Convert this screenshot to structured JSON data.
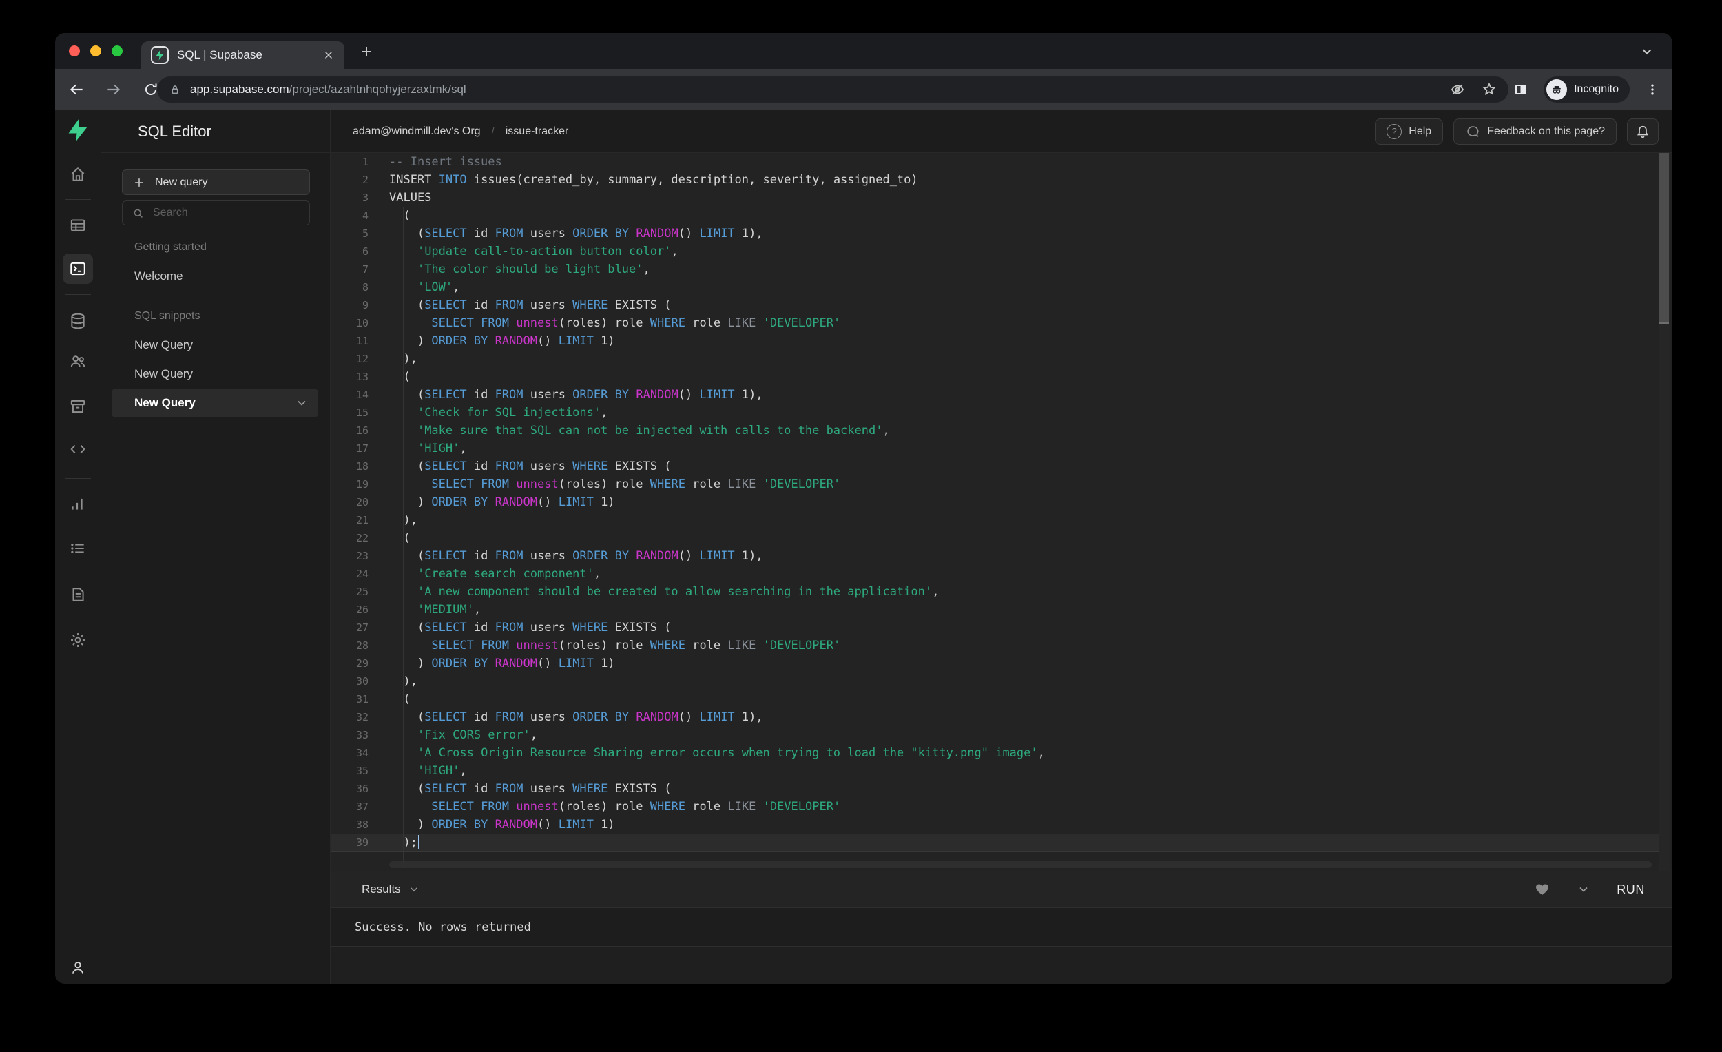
{
  "browser": {
    "tab_title": "SQL | Supabase",
    "url_domain": "app.supabase.com",
    "url_path": "/project/azahtnhqohyjerzaxtmk/sql",
    "incognito_label": "Incognito"
  },
  "header": {
    "breadcrumb_org": "adam@windmill.dev's Org",
    "breadcrumb_separator": "/",
    "breadcrumb_project": "issue-tracker",
    "help_label": "Help",
    "help_icon_glyph": "?",
    "feedback_label": "Feedback on this page?"
  },
  "panel": {
    "title": "SQL Editor",
    "new_query_button": "New query",
    "search_placeholder": "Search",
    "sections": [
      {
        "label": "Getting started",
        "items": [
          "Welcome"
        ],
        "selected_index": -1
      },
      {
        "label": "SQL snippets",
        "items": [
          "New Query",
          "New Query",
          "New Query"
        ],
        "selected_index": 2
      }
    ]
  },
  "colors": {
    "accent_green": "#3ecf8e",
    "keyword": "#569cd6",
    "function": "#ca35ca",
    "string": "#2ea97d",
    "comment": "#6e757d",
    "editor_background": "#232323"
  },
  "editor": {
    "lines": [
      [
        [
          "c",
          "-- Insert issues"
        ]
      ],
      [
        [
          "d",
          "INSERT "
        ],
        [
          "k",
          "INTO"
        ],
        [
          "d",
          " issues(created_by, summary, description, severity, assigned_to)"
        ]
      ],
      [
        [
          "d",
          "VALUES"
        ]
      ],
      [
        [
          "d",
          "  ("
        ]
      ],
      [
        [
          "d",
          "    ("
        ],
        [
          "k",
          "SELECT"
        ],
        [
          "d",
          " id "
        ],
        [
          "k",
          "FROM"
        ],
        [
          "d",
          " users "
        ],
        [
          "k",
          "ORDER"
        ],
        [
          "d",
          " "
        ],
        [
          "k",
          "BY"
        ],
        [
          "d",
          " "
        ],
        [
          "f",
          "RANDOM"
        ],
        [
          "d",
          "() "
        ],
        [
          "k",
          "LIMIT"
        ],
        [
          "d",
          " 1),"
        ]
      ],
      [
        [
          "d",
          "    "
        ],
        [
          "s",
          "'Update call-to-action button color'"
        ],
        [
          "d",
          ","
        ]
      ],
      [
        [
          "d",
          "    "
        ],
        [
          "s",
          "'The color should be light blue'"
        ],
        [
          "d",
          ","
        ]
      ],
      [
        [
          "d",
          "    "
        ],
        [
          "s",
          "'LOW'"
        ],
        [
          "d",
          ","
        ]
      ],
      [
        [
          "d",
          "    ("
        ],
        [
          "k",
          "SELECT"
        ],
        [
          "d",
          " id "
        ],
        [
          "k",
          "FROM"
        ],
        [
          "d",
          " users "
        ],
        [
          "k",
          "WHERE"
        ],
        [
          "d",
          " EXISTS ("
        ]
      ],
      [
        [
          "d",
          "      "
        ],
        [
          "k",
          "SELECT"
        ],
        [
          "d",
          " "
        ],
        [
          "k",
          "FROM"
        ],
        [
          "d",
          " "
        ],
        [
          "f",
          "unnest"
        ],
        [
          "d",
          "(roles) role "
        ],
        [
          "k",
          "WHERE"
        ],
        [
          "d",
          " role "
        ],
        [
          "g",
          "LIKE"
        ],
        [
          "d",
          " "
        ],
        [
          "s",
          "'DEVELOPER'"
        ]
      ],
      [
        [
          "d",
          "    ) "
        ],
        [
          "k",
          "ORDER"
        ],
        [
          "d",
          " "
        ],
        [
          "k",
          "BY"
        ],
        [
          "d",
          " "
        ],
        [
          "f",
          "RANDOM"
        ],
        [
          "d",
          "() "
        ],
        [
          "k",
          "LIMIT"
        ],
        [
          "d",
          " 1)"
        ]
      ],
      [
        [
          "d",
          "  ),"
        ]
      ],
      [
        [
          "d",
          "  ("
        ]
      ],
      [
        [
          "d",
          "    ("
        ],
        [
          "k",
          "SELECT"
        ],
        [
          "d",
          " id "
        ],
        [
          "k",
          "FROM"
        ],
        [
          "d",
          " users "
        ],
        [
          "k",
          "ORDER"
        ],
        [
          "d",
          " "
        ],
        [
          "k",
          "BY"
        ],
        [
          "d",
          " "
        ],
        [
          "f",
          "RANDOM"
        ],
        [
          "d",
          "() "
        ],
        [
          "k",
          "LIMIT"
        ],
        [
          "d",
          " 1),"
        ]
      ],
      [
        [
          "d",
          "    "
        ],
        [
          "s",
          "'Check for SQL injections'"
        ],
        [
          "d",
          ","
        ]
      ],
      [
        [
          "d",
          "    "
        ],
        [
          "s",
          "'Make sure that SQL can not be injected with calls to the backend'"
        ],
        [
          "d",
          ","
        ]
      ],
      [
        [
          "d",
          "    "
        ],
        [
          "s",
          "'HIGH'"
        ],
        [
          "d",
          ","
        ]
      ],
      [
        [
          "d",
          "    ("
        ],
        [
          "k",
          "SELECT"
        ],
        [
          "d",
          " id "
        ],
        [
          "k",
          "FROM"
        ],
        [
          "d",
          " users "
        ],
        [
          "k",
          "WHERE"
        ],
        [
          "d",
          " EXISTS ("
        ]
      ],
      [
        [
          "d",
          "      "
        ],
        [
          "k",
          "SELECT"
        ],
        [
          "d",
          " "
        ],
        [
          "k",
          "FROM"
        ],
        [
          "d",
          " "
        ],
        [
          "f",
          "unnest"
        ],
        [
          "d",
          "(roles) role "
        ],
        [
          "k",
          "WHERE"
        ],
        [
          "d",
          " role "
        ],
        [
          "g",
          "LIKE"
        ],
        [
          "d",
          " "
        ],
        [
          "s",
          "'DEVELOPER'"
        ]
      ],
      [
        [
          "d",
          "    ) "
        ],
        [
          "k",
          "ORDER"
        ],
        [
          "d",
          " "
        ],
        [
          "k",
          "BY"
        ],
        [
          "d",
          " "
        ],
        [
          "f",
          "RANDOM"
        ],
        [
          "d",
          "() "
        ],
        [
          "k",
          "LIMIT"
        ],
        [
          "d",
          " 1)"
        ]
      ],
      [
        [
          "d",
          "  ),"
        ]
      ],
      [
        [
          "d",
          "  ("
        ]
      ],
      [
        [
          "d",
          "    ("
        ],
        [
          "k",
          "SELECT"
        ],
        [
          "d",
          " id "
        ],
        [
          "k",
          "FROM"
        ],
        [
          "d",
          " users "
        ],
        [
          "k",
          "ORDER"
        ],
        [
          "d",
          " "
        ],
        [
          "k",
          "BY"
        ],
        [
          "d",
          " "
        ],
        [
          "f",
          "RANDOM"
        ],
        [
          "d",
          "() "
        ],
        [
          "k",
          "LIMIT"
        ],
        [
          "d",
          " 1),"
        ]
      ],
      [
        [
          "d",
          "    "
        ],
        [
          "s",
          "'Create search component'"
        ],
        [
          "d",
          ","
        ]
      ],
      [
        [
          "d",
          "    "
        ],
        [
          "s",
          "'A new component should be created to allow searching in the application'"
        ],
        [
          "d",
          ","
        ]
      ],
      [
        [
          "d",
          "    "
        ],
        [
          "s",
          "'MEDIUM'"
        ],
        [
          "d",
          ","
        ]
      ],
      [
        [
          "d",
          "    ("
        ],
        [
          "k",
          "SELECT"
        ],
        [
          "d",
          " id "
        ],
        [
          "k",
          "FROM"
        ],
        [
          "d",
          " users "
        ],
        [
          "k",
          "WHERE"
        ],
        [
          "d",
          " EXISTS ("
        ]
      ],
      [
        [
          "d",
          "      "
        ],
        [
          "k",
          "SELECT"
        ],
        [
          "d",
          " "
        ],
        [
          "k",
          "FROM"
        ],
        [
          "d",
          " "
        ],
        [
          "f",
          "unnest"
        ],
        [
          "d",
          "(roles) role "
        ],
        [
          "k",
          "WHERE"
        ],
        [
          "d",
          " role "
        ],
        [
          "g",
          "LIKE"
        ],
        [
          "d",
          " "
        ],
        [
          "s",
          "'DEVELOPER'"
        ]
      ],
      [
        [
          "d",
          "    ) "
        ],
        [
          "k",
          "ORDER"
        ],
        [
          "d",
          " "
        ],
        [
          "k",
          "BY"
        ],
        [
          "d",
          " "
        ],
        [
          "f",
          "RANDOM"
        ],
        [
          "d",
          "() "
        ],
        [
          "k",
          "LIMIT"
        ],
        [
          "d",
          " 1)"
        ]
      ],
      [
        [
          "d",
          "  ),"
        ]
      ],
      [
        [
          "d",
          "  ("
        ]
      ],
      [
        [
          "d",
          "    ("
        ],
        [
          "k",
          "SELECT"
        ],
        [
          "d",
          " id "
        ],
        [
          "k",
          "FROM"
        ],
        [
          "d",
          " users "
        ],
        [
          "k",
          "ORDER"
        ],
        [
          "d",
          " "
        ],
        [
          "k",
          "BY"
        ],
        [
          "d",
          " "
        ],
        [
          "f",
          "RANDOM"
        ],
        [
          "d",
          "() "
        ],
        [
          "k",
          "LIMIT"
        ],
        [
          "d",
          " 1),"
        ]
      ],
      [
        [
          "d",
          "    "
        ],
        [
          "s",
          "'Fix CORS error'"
        ],
        [
          "d",
          ","
        ]
      ],
      [
        [
          "d",
          "    "
        ],
        [
          "s",
          "'A Cross Origin Resource Sharing error occurs when trying to load the \"kitty.png\" image'"
        ],
        [
          "d",
          ","
        ]
      ],
      [
        [
          "d",
          "    "
        ],
        [
          "s",
          "'HIGH'"
        ],
        [
          "d",
          ","
        ]
      ],
      [
        [
          "d",
          "    ("
        ],
        [
          "k",
          "SELECT"
        ],
        [
          "d",
          " id "
        ],
        [
          "k",
          "FROM"
        ],
        [
          "d",
          " users "
        ],
        [
          "k",
          "WHERE"
        ],
        [
          "d",
          " EXISTS ("
        ]
      ],
      [
        [
          "d",
          "      "
        ],
        [
          "k",
          "SELECT"
        ],
        [
          "d",
          " "
        ],
        [
          "k",
          "FROM"
        ],
        [
          "d",
          " "
        ],
        [
          "f",
          "unnest"
        ],
        [
          "d",
          "(roles) role "
        ],
        [
          "k",
          "WHERE"
        ],
        [
          "d",
          " role "
        ],
        [
          "g",
          "LIKE"
        ],
        [
          "d",
          " "
        ],
        [
          "s",
          "'DEVELOPER'"
        ]
      ],
      [
        [
          "d",
          "    ) "
        ],
        [
          "k",
          "ORDER"
        ],
        [
          "d",
          " "
        ],
        [
          "k",
          "BY"
        ],
        [
          "d",
          " "
        ],
        [
          "f",
          "RANDOM"
        ],
        [
          "d",
          "() "
        ],
        [
          "k",
          "LIMIT"
        ],
        [
          "d",
          " 1)"
        ]
      ],
      [
        [
          "d",
          "  );"
        ]
      ]
    ]
  },
  "results": {
    "label": "Results",
    "run_label": "RUN",
    "message": "Success. No rows returned"
  }
}
